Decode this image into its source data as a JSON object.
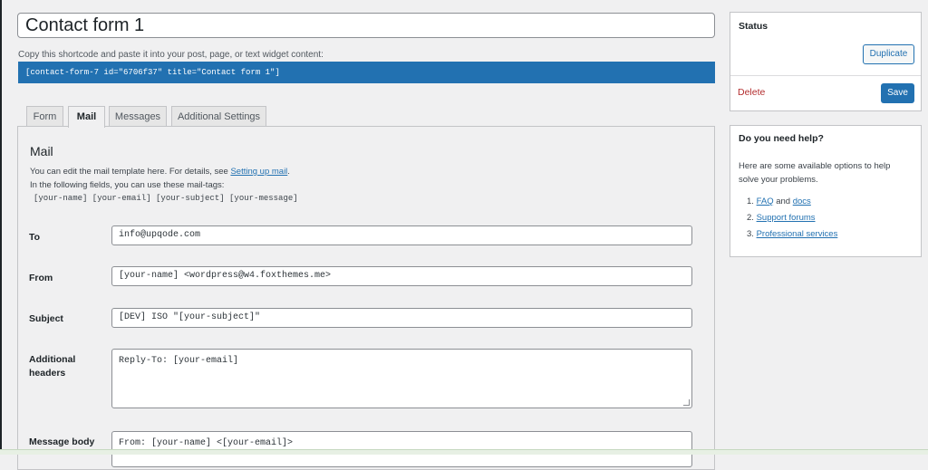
{
  "form": {
    "title": "Contact form 1",
    "shortcode_label": "Copy this shortcode and paste it into your post, page, or text widget content:",
    "shortcode": "[contact-form-7 id=\"6706f37\" title=\"Contact form 1\"]"
  },
  "tabs": [
    {
      "label": "Form",
      "active": false
    },
    {
      "label": "Mail",
      "active": true
    },
    {
      "label": "Messages",
      "active": false
    },
    {
      "label": "Additional Settings",
      "active": false
    }
  ],
  "mail": {
    "heading": "Mail",
    "desc_prefix": "You can edit the mail template here. For details, see ",
    "desc_link": "Setting up mail",
    "desc_suffix": ".",
    "desc_line2": "In the following fields, you can use these mail-tags:",
    "tags": "[your-name] [your-email] [your-subject] [your-message]",
    "fields": {
      "to": {
        "label": "To",
        "value": "info@upqode.com"
      },
      "from": {
        "label": "From",
        "value": "[your-name] <wordpress@w4.foxthemes.me>"
      },
      "subject": {
        "label": "Subject",
        "value": "[DEV] ISO \"[your-subject]\""
      },
      "headers": {
        "label_line1": "Additional",
        "label_line2": "headers",
        "value": "Reply-To: [your-email]"
      },
      "body": {
        "label": "Message body",
        "value": "From: [your-name] <[your-email]>"
      }
    }
  },
  "status": {
    "title": "Status",
    "duplicate": "Duplicate",
    "delete": "Delete",
    "save": "Save"
  },
  "help": {
    "title": "Do you need help?",
    "text": "Here are some available options to help solve your problems.",
    "item1_num": "1.",
    "item1_link_a": "FAQ",
    "item1_and": " and ",
    "item1_link_b": "docs",
    "item2_num": "2.",
    "item2_link": "Support forums",
    "item3_num": "3.",
    "item3_link": "Professional services"
  },
  "colors": {
    "accent": "#2271b1",
    "danger": "#b32d2e",
    "background": "#f0f0f1"
  }
}
